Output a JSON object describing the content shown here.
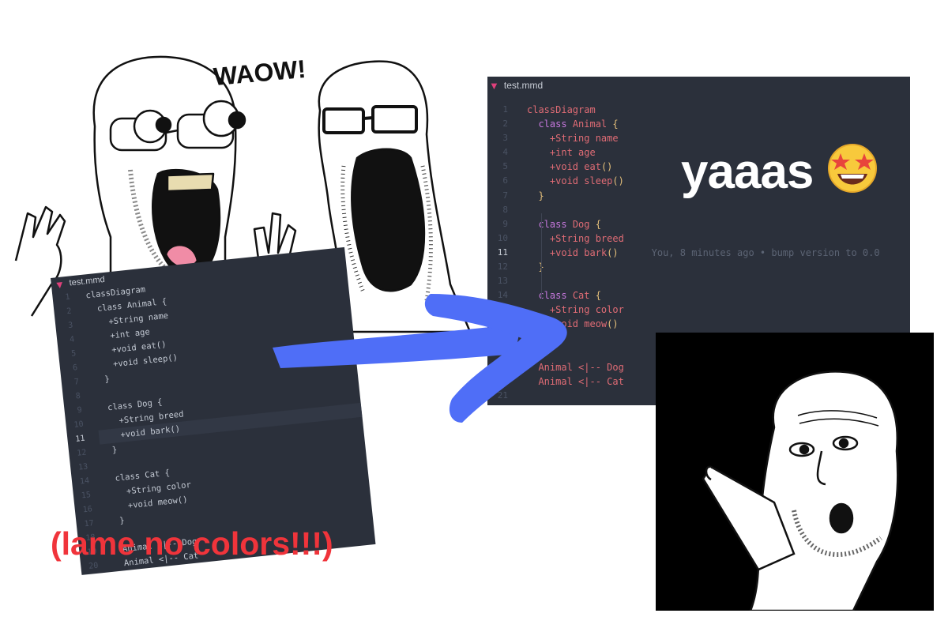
{
  "editor_right": {
    "tab_name": "test.mmd",
    "active_line": 11,
    "blame": "You, 8 minutes ago • bump version to 0.0",
    "lines": [
      {
        "n": "1",
        "i": 0,
        "t": [
          [
            "classDiagram",
            "nm"
          ]
        ]
      },
      {
        "n": "2",
        "i": 1,
        "t": [
          [
            "class ",
            "kw"
          ],
          [
            "Animal ",
            "nm"
          ],
          [
            "{",
            "pu"
          ]
        ]
      },
      {
        "n": "3",
        "i": 2,
        "t": [
          [
            "+String ",
            "nm"
          ],
          [
            "name",
            "nm"
          ]
        ]
      },
      {
        "n": "4",
        "i": 2,
        "t": [
          [
            "+int ",
            "nm"
          ],
          [
            "age",
            "nm"
          ]
        ]
      },
      {
        "n": "5",
        "i": 2,
        "t": [
          [
            "+void ",
            "nm"
          ],
          [
            "eat",
            "nm"
          ],
          [
            "()",
            "pu"
          ]
        ]
      },
      {
        "n": "6",
        "i": 2,
        "t": [
          [
            "+void ",
            "nm"
          ],
          [
            "sleep",
            "nm"
          ],
          [
            "()",
            "pu"
          ]
        ]
      },
      {
        "n": "7",
        "i": 1,
        "t": [
          [
            "}",
            "pu"
          ]
        ]
      },
      {
        "n": "8",
        "i": 0,
        "t": []
      },
      {
        "n": "9",
        "i": 1,
        "t": [
          [
            "class ",
            "kw"
          ],
          [
            "Dog ",
            "nm"
          ],
          [
            "{",
            "pu"
          ]
        ]
      },
      {
        "n": "10",
        "i": 2,
        "t": [
          [
            "+String ",
            "nm"
          ],
          [
            "breed",
            "nm"
          ]
        ]
      },
      {
        "n": "11",
        "i": 2,
        "t": [
          [
            "+void ",
            "nm"
          ],
          [
            "bark",
            "nm"
          ],
          [
            "()",
            "pu"
          ]
        ]
      },
      {
        "n": "12",
        "i": 1,
        "t": [
          [
            "}",
            "pu"
          ]
        ]
      },
      {
        "n": "13",
        "i": 0,
        "t": []
      },
      {
        "n": "14",
        "i": 1,
        "t": [
          [
            "class ",
            "kw"
          ],
          [
            "Cat ",
            "nm"
          ],
          [
            "{",
            "pu"
          ]
        ]
      },
      {
        "n": "15",
        "i": 2,
        "t": [
          [
            "+String ",
            "nm"
          ],
          [
            "color",
            "nm"
          ]
        ]
      },
      {
        "n": "16",
        "i": 2,
        "t": [
          [
            "+void ",
            "nm"
          ],
          [
            "meow",
            "nm"
          ],
          [
            "()",
            "pu"
          ]
        ]
      },
      {
        "n": "17",
        "i": 1,
        "t": [
          [
            "}",
            "pu"
          ]
        ]
      },
      {
        "n": "18",
        "i": 0,
        "t": []
      },
      {
        "n": "19",
        "i": 1,
        "t": [
          [
            "Animal <|-- Dog",
            "nm"
          ]
        ]
      },
      {
        "n": "20",
        "i": 1,
        "t": [
          [
            "Animal <|-- Cat",
            "nm"
          ]
        ]
      },
      {
        "n": "21",
        "i": 0,
        "t": []
      }
    ]
  },
  "editor_left": {
    "tab_name": "test.mmd",
    "active_line": 11,
    "lines": [
      {
        "n": "1",
        "i": 0,
        "t": "classDiagram"
      },
      {
        "n": "2",
        "i": 1,
        "t": "class Animal {"
      },
      {
        "n": "3",
        "i": 2,
        "t": "+String name"
      },
      {
        "n": "4",
        "i": 2,
        "t": "+int age"
      },
      {
        "n": "5",
        "i": 2,
        "t": "+void eat()"
      },
      {
        "n": "6",
        "i": 2,
        "t": "+void sleep()"
      },
      {
        "n": "7",
        "i": 1,
        "t": "}"
      },
      {
        "n": "8",
        "i": 0,
        "t": ""
      },
      {
        "n": "9",
        "i": 1,
        "t": "class Dog {"
      },
      {
        "n": "10",
        "i": 2,
        "t": "+String breed"
      },
      {
        "n": "11",
        "i": 2,
        "t": "+void bark()"
      },
      {
        "n": "12",
        "i": 1,
        "t": "}"
      },
      {
        "n": "13",
        "i": 0,
        "t": ""
      },
      {
        "n": "14",
        "i": 1,
        "t": "class Cat {"
      },
      {
        "n": "15",
        "i": 2,
        "t": "+String color"
      },
      {
        "n": "16",
        "i": 2,
        "t": "+void meow()"
      },
      {
        "n": "17",
        "i": 1,
        "t": "}"
      },
      {
        "n": "18",
        "i": 0,
        "t": ""
      },
      {
        "n": "19",
        "i": 1,
        "t": "Animal <|-- Dog"
      },
      {
        "n": "20",
        "i": 1,
        "t": "Animal <|-- Cat"
      }
    ]
  },
  "captions": {
    "yaaas": "yaaas",
    "yaaas_emoji": "star-struck-emoji-icon",
    "lame": "(lame no colors!!!)",
    "waow": "WAOW!"
  },
  "colors": {
    "editor_bg": "#2b303b",
    "keyword": "#c678dd",
    "identifier": "#e06c75",
    "brace": "#e5c07b",
    "arrow": "#4f6ef7",
    "caption_red": "#f0343b",
    "tab_logo": "#e0407b"
  }
}
